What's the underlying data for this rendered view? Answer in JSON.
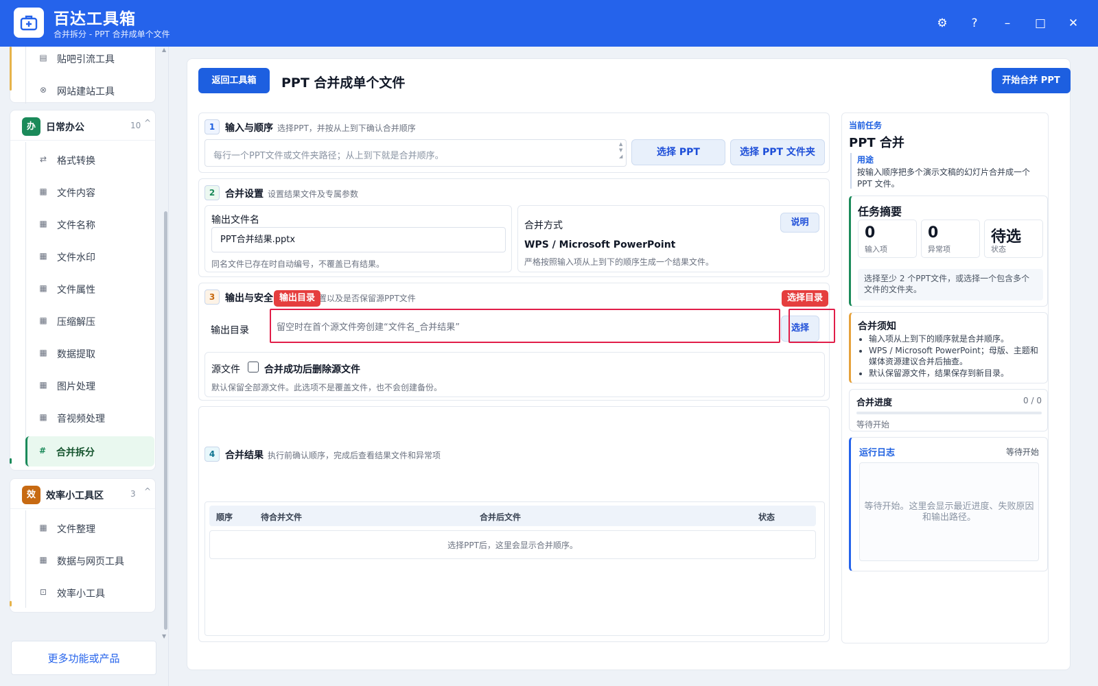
{
  "titlebar": {
    "title": "百达工具箱",
    "subtitle": "合并拆分 - PPT 合并成单个文件",
    "settings_glyph": "⚙",
    "help_glyph": "?",
    "minimize_glyph": "–",
    "maximize_glyph": "□",
    "close_glyph": "✕"
  },
  "sidebar": {
    "top_items": [
      {
        "label": "贴吧引流工具",
        "icon": "doc-icon",
        "glyph": "▤"
      },
      {
        "label": "网站建站工具",
        "icon": "gear-icon",
        "glyph": "⊗"
      }
    ],
    "groups": [
      {
        "badge": "办",
        "badge_color": "#1b8a5a",
        "title": "日常办公",
        "count": "10",
        "caret": "^",
        "items": [
          {
            "label": "格式转换",
            "glyph": "⇄",
            "icon": "swap-icon"
          },
          {
            "label": "文件内容",
            "glyph": "▦",
            "icon": "grid-icon"
          },
          {
            "label": "文件名称",
            "glyph": "▦",
            "icon": "grid-icon"
          },
          {
            "label": "文件水印",
            "glyph": "▦",
            "icon": "grid-icon"
          },
          {
            "label": "文件属性",
            "glyph": "▦",
            "icon": "grid-icon"
          },
          {
            "label": "压缩解压",
            "glyph": "▦",
            "icon": "grid-icon"
          },
          {
            "label": "数据提取",
            "glyph": "▦",
            "icon": "grid-icon"
          },
          {
            "label": "图片处理",
            "glyph": "▦",
            "icon": "grid-icon"
          },
          {
            "label": "音视频处理",
            "glyph": "▦",
            "icon": "grid-icon"
          },
          {
            "label": "合并拆分",
            "glyph": "#",
            "icon": "hash-icon",
            "active": true
          }
        ]
      },
      {
        "badge": "效",
        "badge_color": "#c76a12",
        "title": "效率小工具区",
        "count": "3",
        "caret": "^",
        "items": [
          {
            "label": "文件整理",
            "glyph": "▦",
            "icon": "grid-icon"
          },
          {
            "label": "数据与网页工具",
            "glyph": "▦",
            "icon": "grid-icon"
          },
          {
            "label": "效率小工具",
            "glyph": "⊡",
            "icon": "toolbox-icon"
          }
        ]
      }
    ],
    "more_label": "更多功能或产品"
  },
  "main": {
    "back_label": "返回工具箱",
    "title": "PPT 合并成单个文件",
    "start_label": "开始合并 PPT",
    "step1": {
      "num": "1",
      "title": "输入与顺序",
      "desc": "选择PPT，并按从上到下确认合并顺序",
      "placeholder": "每行一个PPT文件或文件夹路径；从上到下就是合并顺序。",
      "select_ppt": "选择 PPT",
      "select_folder": "选择 PPT 文件夹"
    },
    "step2": {
      "num": "2",
      "title": "合并设置",
      "desc": "设置结果文件及专属参数",
      "out_name_label": "输出文件名",
      "out_name_value": "PPT合并结果.pptx",
      "out_name_note": "同名文件已存在时自动编号，不覆盖已有结果。",
      "method_label": "合并方式",
      "method_help": "说明",
      "method_value": "WPS / Microsoft PowerPoint",
      "method_note": "严格按照输入项从上到下的顺序生成一个结果文件。"
    },
    "step3": {
      "num": "3",
      "title": "输出与安全",
      "desc": "置以及是否保留源PPT文件",
      "tag_dir": "输出目录",
      "tag_select": "选择目录",
      "dir_label": "输出目录",
      "dir_placeholder": "留空时在首个源文件旁创建“文件名_合并结果”",
      "select_label": "选择",
      "source_label": "源文件",
      "delete_label": "合并成功后删除源文件",
      "source_note": "默认保留全部源文件。此选项不是覆盖文件，也不会创建备份。"
    },
    "step4": {
      "num": "4",
      "title": "合并结果",
      "desc": "执行前确认顺序，完成后查看结果文件和异常项",
      "columns": [
        "顺序",
        "待合并文件",
        "合并后文件",
        "状态"
      ],
      "empty_text": "选择PPT后，这里会显示合并顺序。"
    }
  },
  "right": {
    "current_label": "当前任务",
    "task_title": "PPT 合并",
    "usage_label": "用途",
    "usage_text": "按输入顺序把多个演示文稿的幻灯片合并成一个PPT 文件。",
    "summary_title": "任务摘要",
    "stats": [
      {
        "value": "0",
        "label": "输入项"
      },
      {
        "value": "0",
        "label": "异常项"
      },
      {
        "value": "待选",
        "label": "状态"
      }
    ],
    "summary_note": "选择至少 2 个PPT文件，或选择一个包含多个文件的文件夹。",
    "notes_title": "合并须知",
    "notes": [
      "输入项从上到下的顺序就是合并顺序。",
      "WPS / Microsoft PowerPoint；母版、主题和媒体资源建议合并后抽查。",
      "默认保留源文件，结果保存到新目录。"
    ],
    "progress_title": "合并进度",
    "progress_count": "0 / 0",
    "progress_value": 0,
    "progress_status": "等待开始",
    "log_title": "运行日志",
    "log_status": "等待开始",
    "log_placeholder": "等待开始。这里会显示最近进度、失败原因和输出路径。"
  },
  "colors": {
    "titlebar": "#2563eb",
    "primary": "#1d5fe0",
    "highlight": "#e11d48",
    "active_green": "#1b8a5a",
    "warning_border": "#e6a23c"
  }
}
